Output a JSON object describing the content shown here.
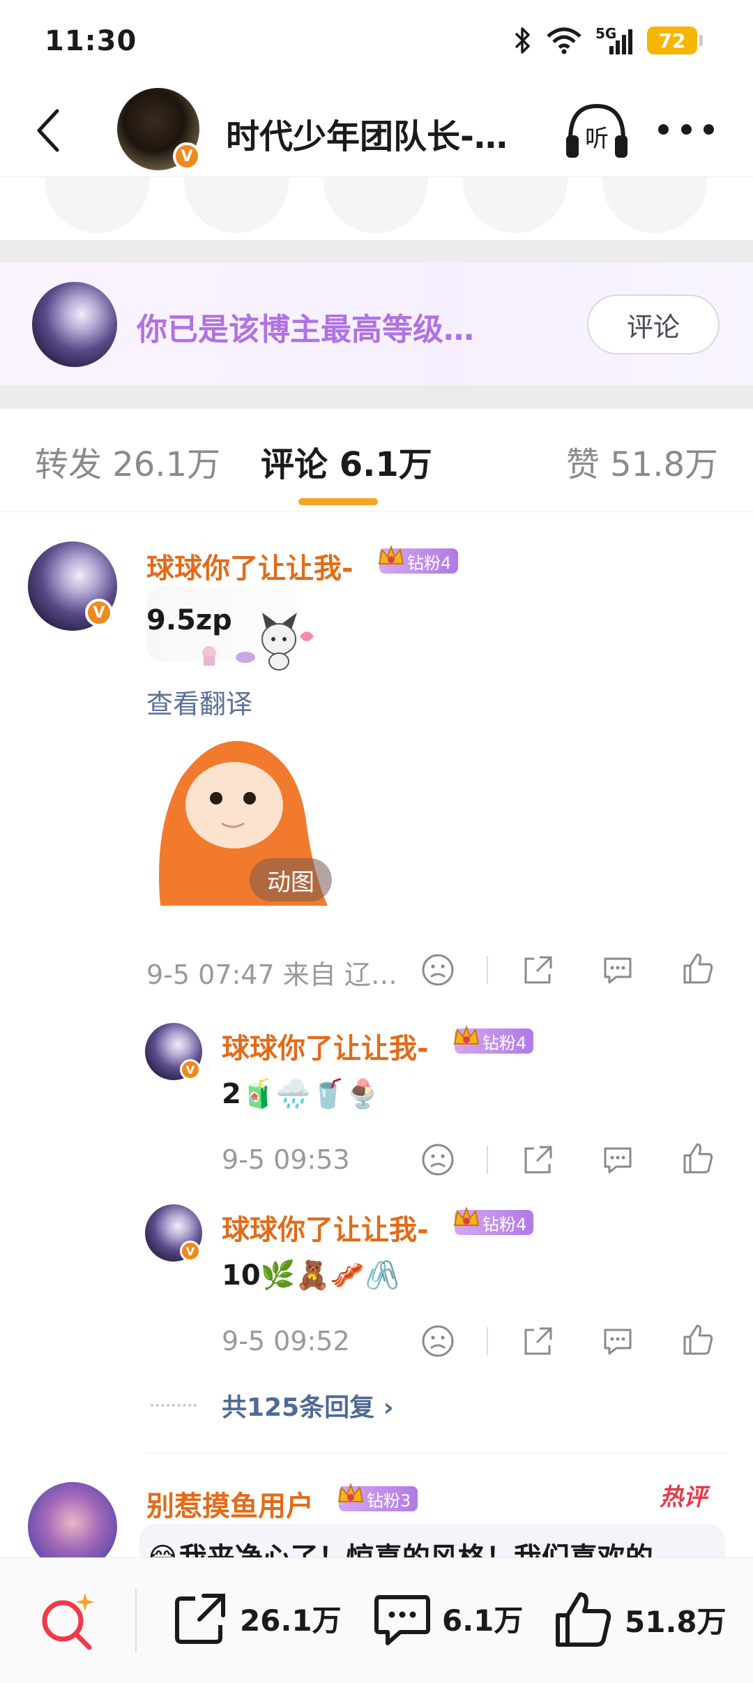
{
  "status_bar": {
    "time": "11:30",
    "network": "5G",
    "battery": "72"
  },
  "header": {
    "title": "时代少年团队长-…",
    "verified_mark": "V"
  },
  "fan_banner": {
    "text": "你已是该博主最高等级…",
    "button_label": "评论"
  },
  "tabs": [
    {
      "label": "转发 26.1万"
    },
    {
      "label": "评论 6.1万"
    },
    {
      "label": "赞 51.8万"
    }
  ],
  "comments": [
    {
      "username": "球球你了让让我-",
      "badge": "钻粉4",
      "text": "9.5zp",
      "translate": "查看翻译",
      "gif_tag": "动图",
      "meta": "9-5 07:47  来自 辽…",
      "verified_mark": "V"
    },
    {
      "username": "球球你了让让我-",
      "badge": "钻粉4",
      "text": "2🧃🌧️🥤🍨",
      "meta": "9-5 09:53"
    },
    {
      "username": "球球你了让让我-",
      "badge": "钻粉4",
      "text": "10🌿🧸🥓🖇️",
      "meta": "9-5 09:52"
    }
  ],
  "reply_count": "共125条回复",
  "next_comment": {
    "username": "别惹摸鱼用户",
    "badge": "钻粉3",
    "hot": "热评",
    "text_preview": "😂我来净心了！惊喜的风格！我们喜欢的"
  },
  "bottom_bar": {
    "repost": "26.1万",
    "comment": "6.1万",
    "like": "51.8万"
  },
  "colors": {
    "accent": "#f5a623",
    "username": "#e06c1a",
    "link": "#5b6f98",
    "fan_text": "#b072e0"
  }
}
